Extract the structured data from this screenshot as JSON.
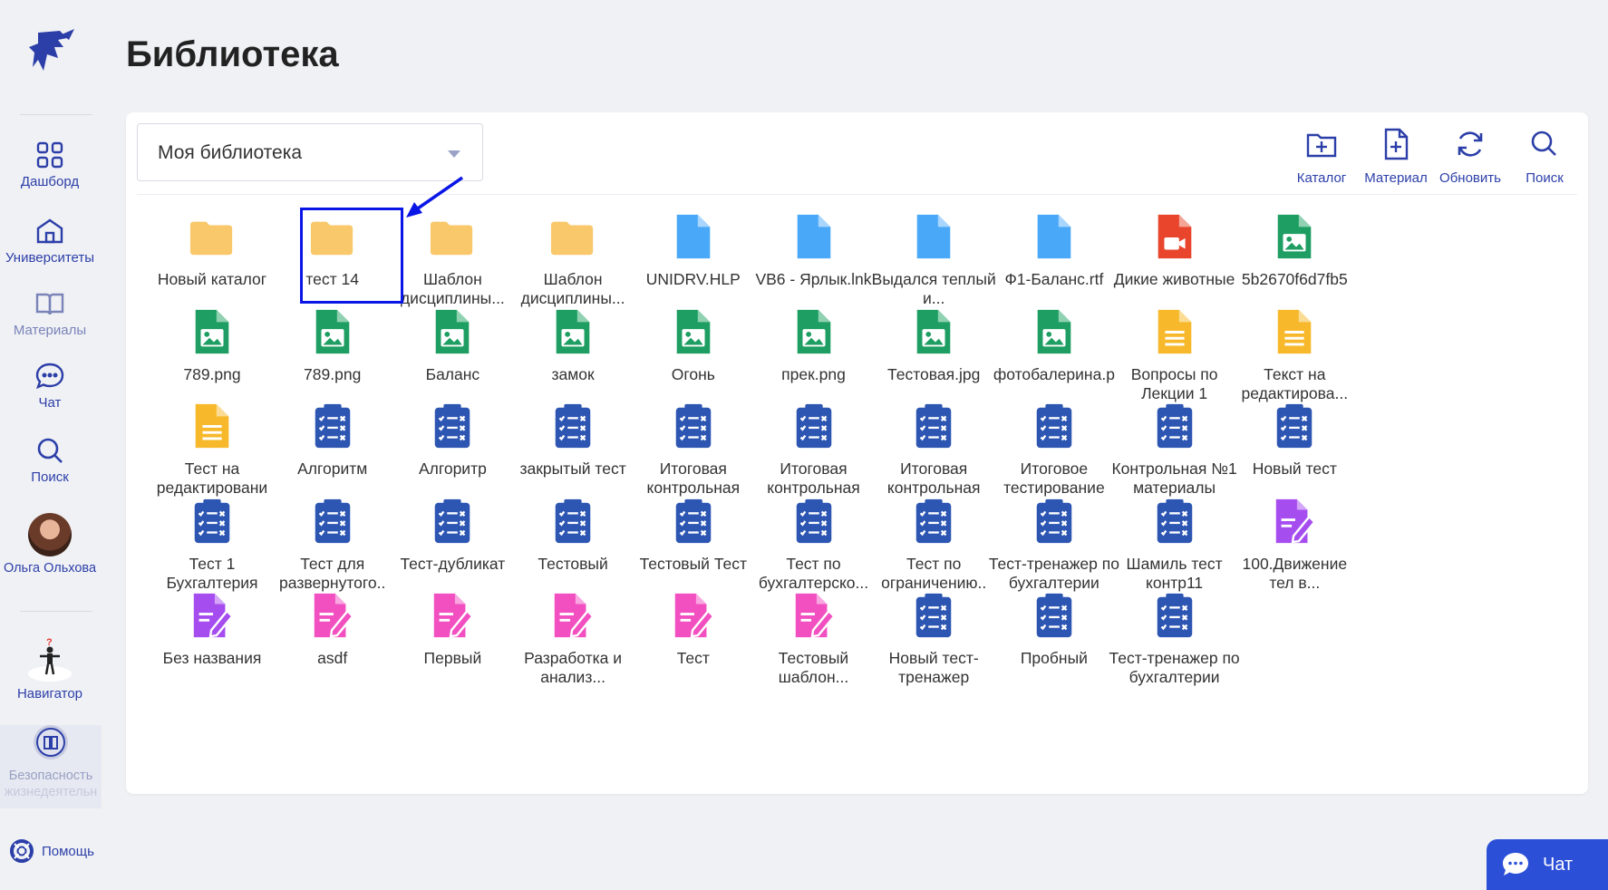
{
  "page_title": "Библиотека",
  "sidebar": {
    "items": [
      {
        "label": "Дашборд",
        "icon": "grid-icon"
      },
      {
        "label": "Университеты",
        "icon": "university-icon"
      },
      {
        "label": "Материалы",
        "icon": "book-icon"
      },
      {
        "label": "Чат",
        "icon": "chat-bubble-icon"
      },
      {
        "label": "Поиск",
        "icon": "search-icon"
      }
    ],
    "user_name": "Ольга Ольхова",
    "navigator_label": "Навигатор",
    "bzh_label_1": "Безопасность",
    "bzh_label_2": "жизнедеятельн",
    "help_label": "Помощь"
  },
  "library_select": {
    "value": "Моя библиотека"
  },
  "toolbar": {
    "catalog": "Каталог",
    "material": "Материал",
    "refresh": "Обновить",
    "search": "Поиск"
  },
  "items": [
    {
      "name": "Новый каталог",
      "kind": "folder"
    },
    {
      "name": "тест 14",
      "kind": "folder"
    },
    {
      "name": "Шаблон дисциплины...",
      "kind": "folder"
    },
    {
      "name": "Шаблон дисциплины...",
      "kind": "folder"
    },
    {
      "name": "UNIDRV.HLP",
      "kind": "file"
    },
    {
      "name": "VB6 - Ярлык.lnk",
      "kind": "file"
    },
    {
      "name": "Выдался теплый и...",
      "kind": "file"
    },
    {
      "name": "Ф1-Баланс.rtf",
      "kind": "file"
    },
    {
      "name": "Дикие животные",
      "kind": "video"
    },
    {
      "name": "5b2670f6d7fb5",
      "kind": "image"
    },
    {
      "name": "789.png",
      "kind": "image"
    },
    {
      "name": "789.png",
      "kind": "image"
    },
    {
      "name": "Баланс",
      "kind": "image"
    },
    {
      "name": "замок",
      "kind": "image"
    },
    {
      "name": "Огонь",
      "kind": "image"
    },
    {
      "name": "прек.png",
      "kind": "image"
    },
    {
      "name": "Тестовая.jpg",
      "kind": "image"
    },
    {
      "name": "фотобалерина.p",
      "kind": "image"
    },
    {
      "name": "Вопросы по Лекции 1",
      "kind": "doc"
    },
    {
      "name": "Текст на редактирова...",
      "kind": "doc"
    },
    {
      "name": "Тест на редактировани",
      "kind": "doc"
    },
    {
      "name": "Алгоритм",
      "kind": "test"
    },
    {
      "name": "Алгоритр",
      "kind": "test"
    },
    {
      "name": "закрытый тест",
      "kind": "test"
    },
    {
      "name": "Итоговая контрольная",
      "kind": "test"
    },
    {
      "name": "Итоговая контрольная",
      "kind": "test"
    },
    {
      "name": "Итоговая контрольная",
      "kind": "test"
    },
    {
      "name": "Итоговое тестирование",
      "kind": "test"
    },
    {
      "name": "Контрольная №1 материалы",
      "kind": "test"
    },
    {
      "name": "Новый тест",
      "kind": "test"
    },
    {
      "name": "Тест 1 Бухгалтерия",
      "kind": "test"
    },
    {
      "name": "Тест для развернутого..",
      "kind": "test"
    },
    {
      "name": "Тест-дубликат",
      "kind": "test"
    },
    {
      "name": "Тестовый",
      "kind": "test"
    },
    {
      "name": "Тестовый Тест",
      "kind": "test"
    },
    {
      "name": "Тест по бухгалтерско...",
      "kind": "test"
    },
    {
      "name": "Тест по ограничению..",
      "kind": "test"
    },
    {
      "name": "Тест-тренажер по бухгалтерии",
      "kind": "test"
    },
    {
      "name": "Шамиль тест контр11",
      "kind": "test"
    },
    {
      "name": "100.Движение тел в...",
      "kind": "edit-purple"
    },
    {
      "name": "Без названия",
      "kind": "edit-purple"
    },
    {
      "name": "asdf",
      "kind": "edit-pink"
    },
    {
      "name": "Первый",
      "kind": "edit-pink"
    },
    {
      "name": "Разработка и анализ...",
      "kind": "edit-pink"
    },
    {
      "name": "Тест",
      "kind": "edit-pink"
    },
    {
      "name": "Тестовый шаблон...",
      "kind": "edit-pink"
    },
    {
      "name": "Новый тест-тренажер",
      "kind": "test"
    },
    {
      "name": "Пробный",
      "kind": "test"
    },
    {
      "name": "Тест-тренажер по бухгалтерии",
      "kind": "test"
    }
  ],
  "chat_button": {
    "label": "Чат"
  },
  "colors": {
    "accent": "#2c3fa8",
    "folder": "#f9c86a",
    "file": "#4aa8f8",
    "image": "#1e9e62",
    "video": "#e8452c",
    "doc": "#f7b92b",
    "test": "#2d56b3",
    "edit_purple": "#a64df0",
    "edit_pink": "#f24fc1",
    "highlight": "#0a16e6",
    "chat_button": "#2c4fd8"
  }
}
